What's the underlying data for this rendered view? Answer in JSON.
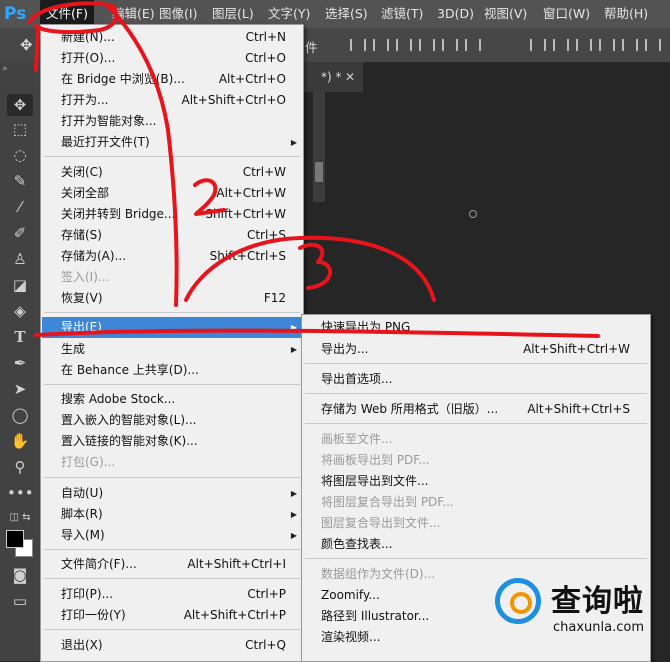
{
  "app": {
    "logo_text": "Ps"
  },
  "menubar": [
    {
      "label": "文件(F)",
      "active": true
    },
    {
      "label": "编辑(E)"
    },
    {
      "label": "图像(I)"
    },
    {
      "label": "图层(L)"
    },
    {
      "label": "文字(Y)"
    },
    {
      "label": "选择(S)"
    },
    {
      "label": "滤镜(T)"
    },
    {
      "label": "3D(D)"
    },
    {
      "label": "视图(V)"
    },
    {
      "label": "窗口(W)"
    },
    {
      "label": "帮助(H)"
    }
  ],
  "options_bar": {
    "visible_text": "件"
  },
  "document_tab": {
    "title": "*) *"
  },
  "file_menu": {
    "items": [
      {
        "label": "新建(N)...",
        "shortcut": "Ctrl+N"
      },
      {
        "label": "打开(O)...",
        "shortcut": "Ctrl+O"
      },
      {
        "label": "在 Bridge 中浏览(B)...",
        "shortcut": "Alt+Ctrl+O"
      },
      {
        "label": "打开为...",
        "shortcut": "Alt+Shift+Ctrl+O"
      },
      {
        "label": "打开为智能对象..."
      },
      {
        "label": "最近打开文件(T)",
        "submenu": true
      },
      {
        "label": "关闭(C)",
        "shortcut": "Ctrl+W"
      },
      {
        "label": "关闭全部",
        "shortcut": "Alt+Ctrl+W"
      },
      {
        "label": "关闭并转到 Bridge...",
        "shortcut": "Shift+Ctrl+W"
      },
      {
        "label": "存储(S)",
        "shortcut": "Ctrl+S"
      },
      {
        "label": "存储为(A)...",
        "shortcut": "Shift+Ctrl+S"
      },
      {
        "label": "签入(I)...",
        "disabled": true
      },
      {
        "label": "恢复(V)",
        "shortcut": "F12"
      },
      {
        "label": "导出(E)",
        "submenu": true,
        "highlight": true
      },
      {
        "label": "生成",
        "submenu": true
      },
      {
        "label": "在 Behance 上共享(D)..."
      },
      {
        "label": "搜索 Adobe Stock..."
      },
      {
        "label": "置入嵌入的智能对象(L)..."
      },
      {
        "label": "置入链接的智能对象(K)..."
      },
      {
        "label": "打包(G)...",
        "disabled": true
      },
      {
        "label": "自动(U)",
        "submenu": true
      },
      {
        "label": "脚本(R)",
        "submenu": true
      },
      {
        "label": "导入(M)",
        "submenu": true
      },
      {
        "label": "文件简介(F)...",
        "shortcut": "Alt+Shift+Ctrl+I"
      },
      {
        "label": "打印(P)...",
        "shortcut": "Ctrl+P"
      },
      {
        "label": "打印一份(Y)",
        "shortcut": "Alt+Shift+Ctrl+P"
      },
      {
        "label": "退出(X)",
        "shortcut": "Ctrl+Q"
      }
    ]
  },
  "export_submenu": {
    "items": [
      {
        "label": "快速导出为 PNG"
      },
      {
        "label": "导出为...",
        "shortcut": "Alt+Shift+Ctrl+W"
      },
      {
        "label": "导出首选项..."
      },
      {
        "label": "存储为 Web 所用格式（旧版）...",
        "shortcut": "Alt+Shift+Ctrl+S"
      },
      {
        "label": "画板至文件...",
        "disabled": true
      },
      {
        "label": "将画板导出到 PDF...",
        "disabled": true
      },
      {
        "label": "将图层导出到文件..."
      },
      {
        "label": "将图层复合导出到 PDF...",
        "disabled": true
      },
      {
        "label": "图层复合导出到文件...",
        "disabled": true
      },
      {
        "label": "颜色查找表..."
      },
      {
        "label": "数据组作为文件(D)...",
        "disabled": true
      },
      {
        "label": "Zoomify..."
      },
      {
        "label": "路径到 Illustrator..."
      },
      {
        "label": "渲染视频..."
      }
    ]
  },
  "tools": [
    "move-icon",
    "marquee-icon",
    "lasso-icon",
    "quick-select-icon",
    "eyedropper-icon",
    "brush-icon",
    "stamp-icon",
    "eraser-icon",
    "paint-bucket-icon",
    "type-icon",
    "pen-icon",
    "path-select-icon",
    "ellipse-icon",
    "hand-icon",
    "zoom-icon",
    "more-icon"
  ],
  "annotations": {
    "numbers": [
      "1",
      "2",
      "3"
    ],
    "color": "#e8141c"
  },
  "watermark": {
    "title": "查询啦",
    "url": "chaxunla.com"
  },
  "colors": {
    "menu_bg": "#f0f0f0",
    "highlight": "#3f86d6",
    "app_bg": "#262626",
    "menubar_bg": "#535353"
  }
}
